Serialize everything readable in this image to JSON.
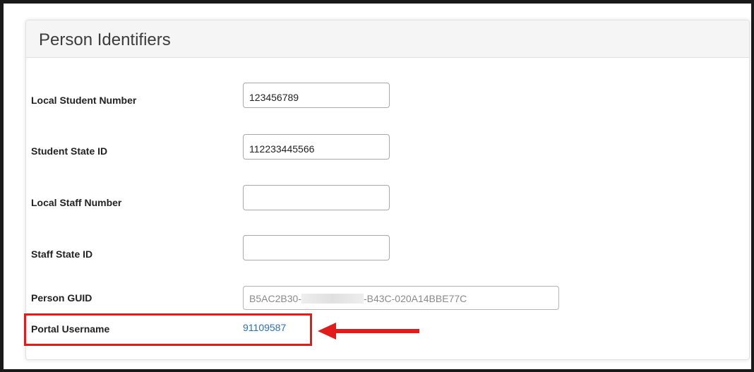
{
  "panel": {
    "title": "Person Identifiers"
  },
  "fields": {
    "local_student_number": {
      "label": "Local Student Number",
      "value": "123456789"
    },
    "student_state_id": {
      "label": "Student State ID",
      "value": "112233445566"
    },
    "local_staff_number": {
      "label": "Local Staff Number",
      "value": ""
    },
    "staff_state_id": {
      "label": "Staff State ID",
      "value": ""
    },
    "person_guid": {
      "label": "Person GUID",
      "value_start": "B5AC2B30-",
      "value_end": "-B43C-020A14BBE77C"
    },
    "portal_username": {
      "label": "Portal Username",
      "value": "91109587"
    }
  },
  "annotation": {
    "highlight_color": "#e21b1b",
    "arrow": "arrow-left-icon"
  }
}
